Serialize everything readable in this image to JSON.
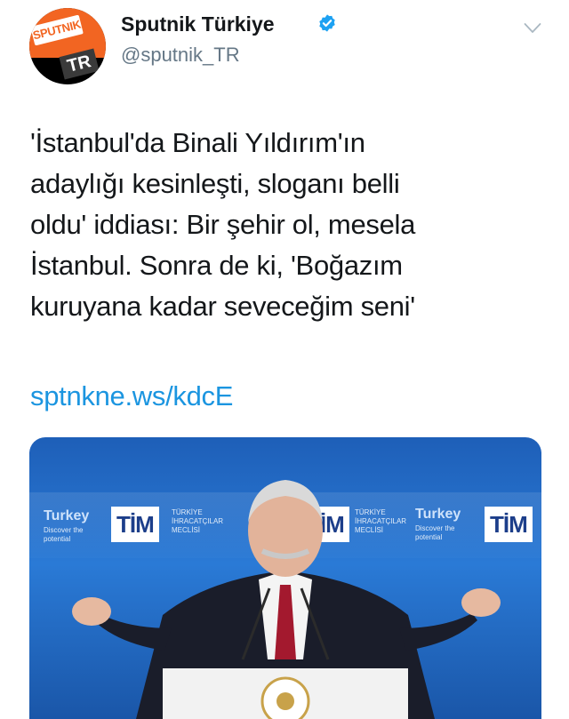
{
  "account": {
    "name": "Sputnik Türkiye",
    "handle": "@sputnik_TR",
    "avatar_top_text": "SPUTNIK",
    "avatar_bottom_text": "TR",
    "verified_icon": "verified-badge-icon",
    "accent_color": "#f26522"
  },
  "tweet": {
    "text_lines": [
      "'İstanbul'da Binali Yıldırım'ın",
      "adaylığı kesinleşti, sloganı belli",
      "oldu' iddiası: Bir şehir ol, mesela",
      "İstanbul. Sonra de ki, 'Boğazım",
      "kuruyana kadar seveceğim seni'"
    ],
    "link": "sptnkne.ws/kdcE",
    "link_color": "#1b95e0"
  },
  "media": {
    "banner_left": "Turkey",
    "banner_mid": "Turkey",
    "tim_label": "TİM",
    "tim_sub": "TÜRKİYE İHRACATÇILAR MECLİSİ",
    "discover_text": "Discover the potential"
  }
}
